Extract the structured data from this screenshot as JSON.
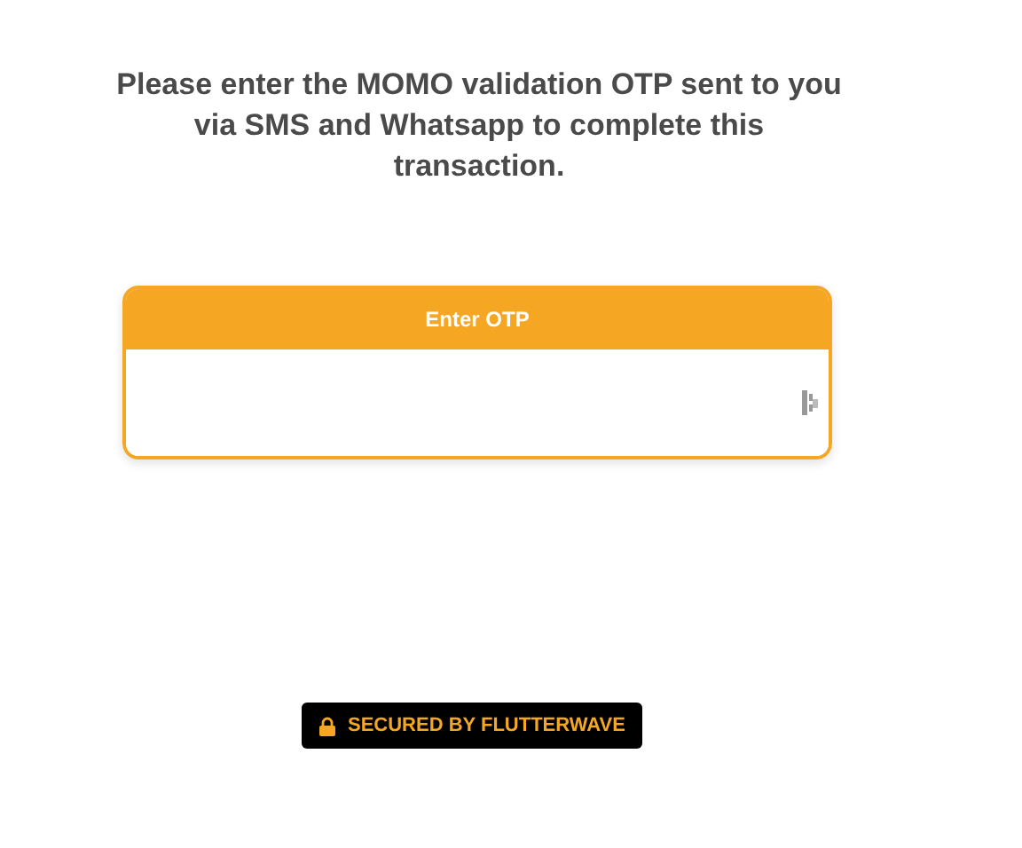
{
  "message": "Please enter the MOMO validation OTP sent to you via SMS and Whatsapp to complete this transaction.",
  "otp_field": {
    "label": "Enter OTP"
  },
  "badge": {
    "text": "SECURED BY FLUTTERWAVE"
  }
}
